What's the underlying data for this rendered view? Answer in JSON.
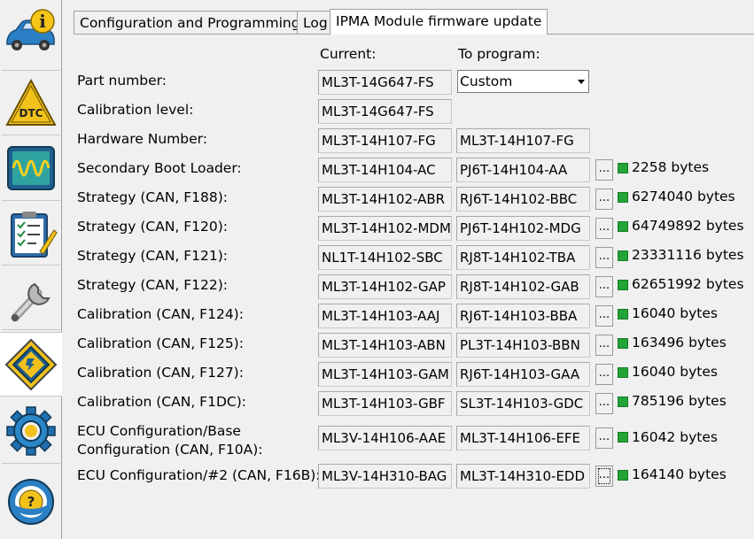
{
  "tabs": [
    "Configuration and Programming",
    "Log",
    "IPMA Module firmware update"
  ],
  "columns": {
    "current": "Current:",
    "to_program": "To program:"
  },
  "sidebar": {
    "items": [
      {
        "icon": "car-info-icon",
        "active": false
      },
      {
        "icon": "dtc-icon",
        "active": false
      },
      {
        "icon": "oscilloscope-icon",
        "active": false
      },
      {
        "icon": "checklist-icon",
        "active": false
      },
      {
        "icon": "wrench-icon",
        "active": false
      },
      {
        "icon": "chip-icon",
        "active": true
      },
      {
        "icon": "gear-icon",
        "active": false
      },
      {
        "icon": "steering-help-icon",
        "active": false
      }
    ]
  },
  "part_number": {
    "label": "Part number:",
    "current": "ML3T-14G647-FS",
    "selected": "Custom"
  },
  "calibration_level": {
    "label": "Calibration level:",
    "current": "ML3T-14G647-FS"
  },
  "hardware_number": {
    "label": "Hardware Number:",
    "current": "ML3T-14H107-FG",
    "to_program": "ML3T-14H107-FG"
  },
  "files": [
    {
      "label": "Secondary Boot Loader:",
      "current": "ML3T-14H104-AC",
      "to_program": "PJ6T-14H104-AA",
      "size": "2258 bytes"
    },
    {
      "label": "Strategy (CAN, F188):",
      "current": "ML3T-14H102-ABR",
      "to_program": "RJ6T-14H102-BBC",
      "size": "6274040 bytes"
    },
    {
      "label": "Strategy (CAN, F120):",
      "current": "ML3T-14H102-MDM",
      "to_program": "PJ6T-14H102-MDG",
      "size": "64749892 bytes"
    },
    {
      "label": "Strategy (CAN, F121):",
      "current": "NL1T-14H102-SBC",
      "to_program": "RJ8T-14H102-TBA",
      "size": "23331116 bytes"
    },
    {
      "label": "Strategy (CAN, F122):",
      "current": "ML3T-14H102-GAP",
      "to_program": "RJ8T-14H102-GAB",
      "size": "62651992 bytes"
    },
    {
      "label": "Calibration (CAN, F124):",
      "current": "ML3T-14H103-AAJ",
      "to_program": "RJ6T-14H103-BBA",
      "size": "16040 bytes"
    },
    {
      "label": "Calibration (CAN, F125):",
      "current": "ML3T-14H103-ABN",
      "to_program": "PL3T-14H103-BBN",
      "size": "163496 bytes"
    },
    {
      "label": "Calibration (CAN, F127):",
      "current": "ML3T-14H103-GAM",
      "to_program": "RJ6T-14H103-GAA",
      "size": "16040 bytes"
    },
    {
      "label": "Calibration (CAN, F1DC):",
      "current": "ML3T-14H103-GBF",
      "to_program": "SL3T-14H103-GDC",
      "size": "785196 bytes"
    },
    {
      "label": "ECU Configuration/Base",
      "label2": "Configuration (CAN, F10A):",
      "current": "ML3V-14H106-AAE",
      "to_program": "ML3T-14H106-EFE",
      "size": "16042 bytes"
    },
    {
      "label": "ECU Configuration/#2 (CAN, F16B):",
      "current": "ML3V-14H310-BAG",
      "to_program": "ML3T-14H310-EDD",
      "size": "164140 bytes"
    }
  ],
  "browse_label": "...",
  "status_color": "#22a437"
}
